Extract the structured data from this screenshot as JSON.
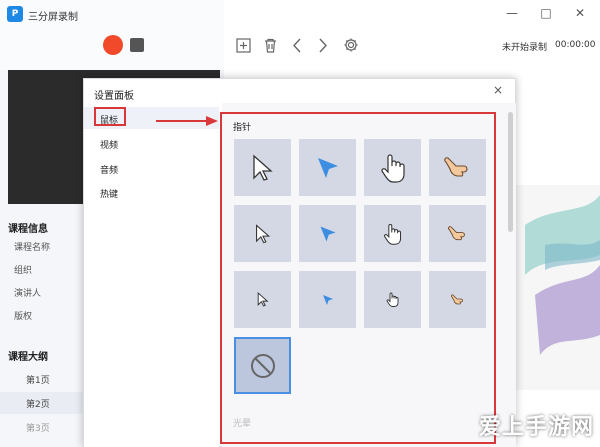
{
  "app": {
    "title": "三分屏录制",
    "logo_text": "P"
  },
  "window_controls": {
    "minimize": "—",
    "maximize": "□",
    "close": "✕"
  },
  "recorder": {
    "status": "未开始录制",
    "time": "00:00:00"
  },
  "left_panel": {
    "course_info_title": "课程信息",
    "course_info_items": [
      "课程名称",
      "组织",
      "演讲人",
      "版权"
    ],
    "outline_title": "课程大纲",
    "pages": [
      "第1页",
      "第2页",
      "第3页"
    ]
  },
  "dialog": {
    "title": "设置面板",
    "close": "×",
    "nav": [
      "鼠标",
      "视频",
      "音频",
      "热键"
    ],
    "active_nav": "鼠标",
    "section_label": "指针",
    "next_section_label": "光晕",
    "pointer_rows": [
      [
        "arrow-white",
        "arrow-blue",
        "hand-white",
        "hand-beige"
      ],
      [
        "arrow-white",
        "arrow-blue",
        "hand-white",
        "hand-beige"
      ],
      [
        "arrow-white",
        "arrow-blue",
        "hand-white",
        "hand-beige"
      ]
    ],
    "extra_option": "none-icon"
  },
  "watermark": "爱上手游网",
  "colors": {
    "accent_red": "#d9383a",
    "record_red": "#f04a2a",
    "selection_blue": "#4a90e2",
    "tile_bg": "#d4d8e4"
  }
}
